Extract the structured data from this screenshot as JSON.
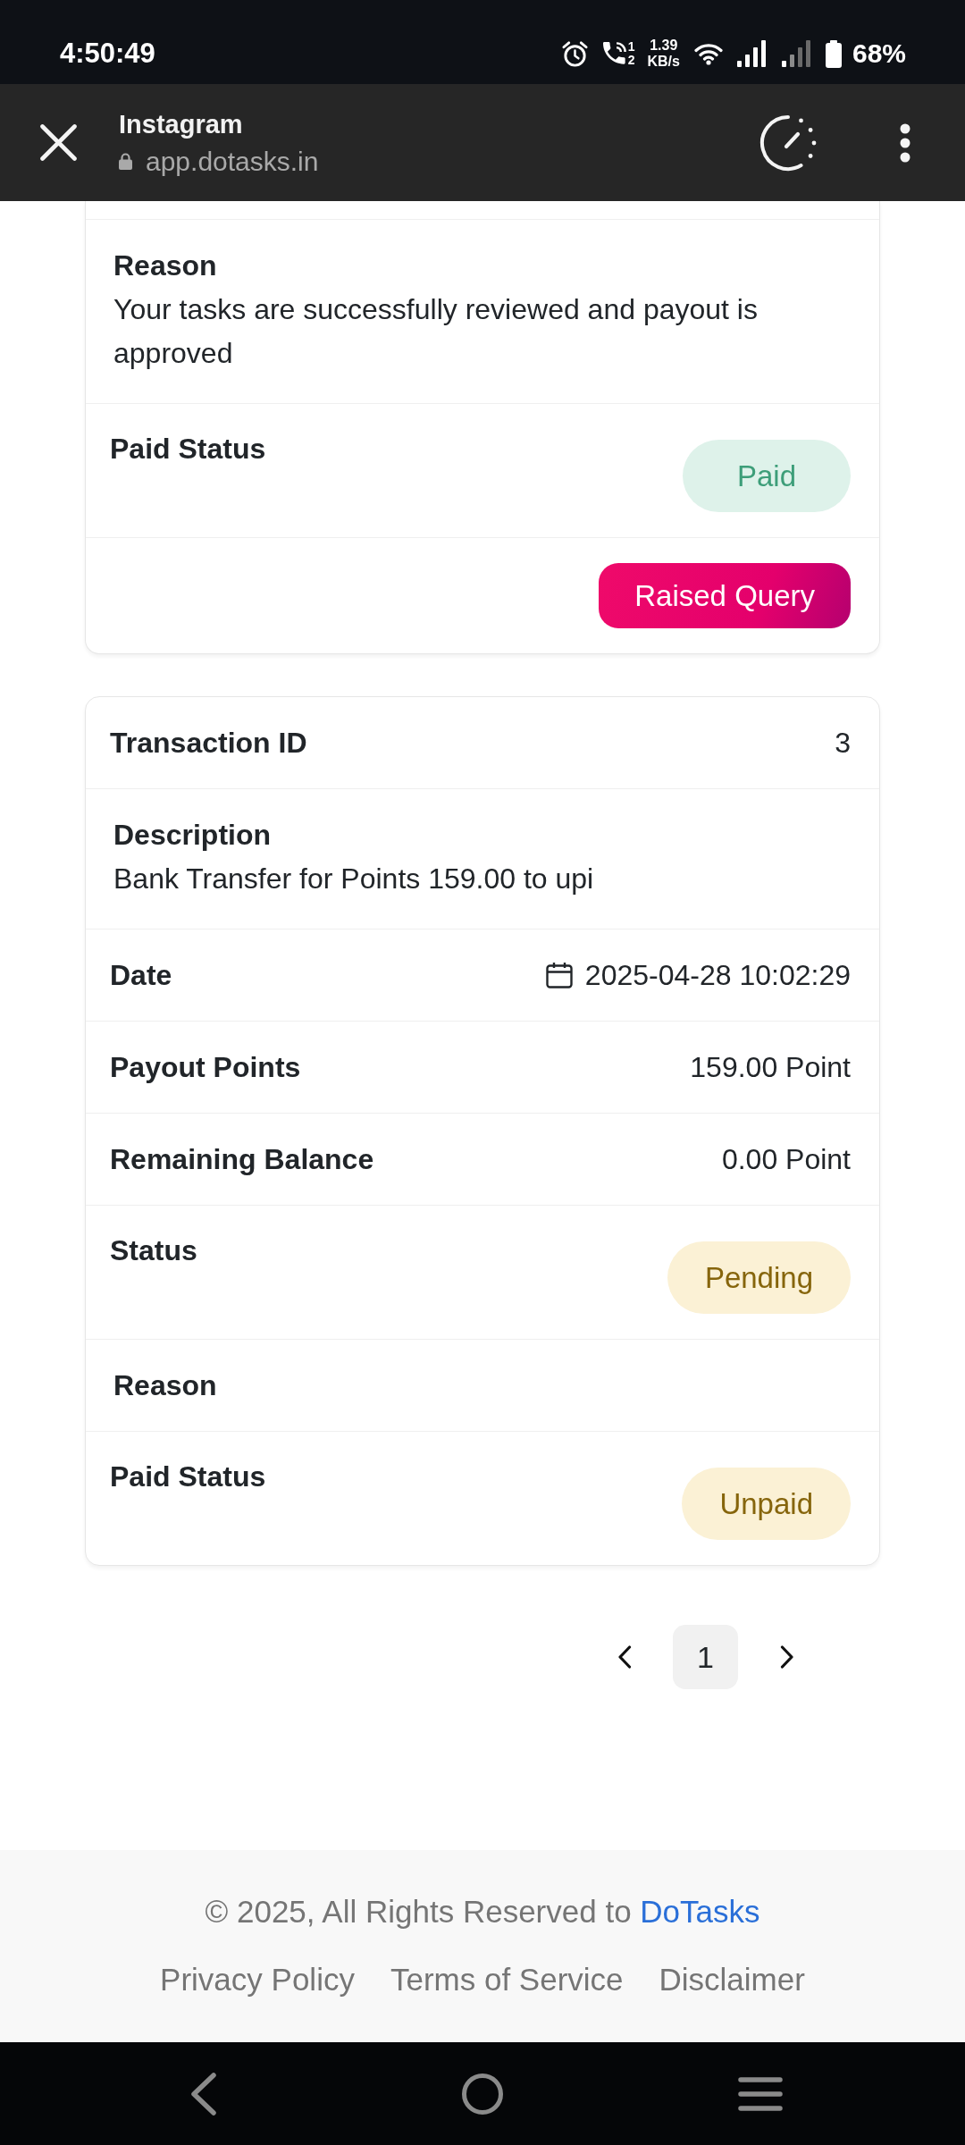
{
  "status_bar": {
    "time": "4:50:49",
    "call_lines": [
      "1",
      "2"
    ],
    "net_speed": {
      "value": "1.39",
      "unit": "KB/s"
    },
    "battery": "68%"
  },
  "browser_bar": {
    "title": "Instagram",
    "url": "app.dotasks.in"
  },
  "transactions": [
    {
      "clipped_top": true,
      "rows": [
        {
          "kind": "block",
          "label": "Reason",
          "value": "Your tasks are successfully reviewed and payout is approved"
        },
        {
          "kind": "badge",
          "label": "Paid Status",
          "badge": {
            "text": "Paid",
            "color": "#3d9e79"
          }
        },
        {
          "kind": "action",
          "button": "Raised Query"
        }
      ]
    },
    {
      "clipped_top": false,
      "rows": [
        {
          "kind": "inline",
          "label": "Transaction ID",
          "value": "3"
        },
        {
          "kind": "block",
          "label": "Description",
          "value": "Bank Transfer for Points 159.00 to upi"
        },
        {
          "kind": "date",
          "label": "Date",
          "value": "2025-04-28 10:02:29"
        },
        {
          "kind": "inline",
          "label": "Payout Points",
          "value": "159.00 Point"
        },
        {
          "kind": "inline",
          "label": "Remaining Balance",
          "value": "0.00 Point"
        },
        {
          "kind": "badge",
          "label": "Status",
          "badge": {
            "text": "Pending",
            "color": "#86650c"
          }
        },
        {
          "kind": "block",
          "label": "Reason"
        },
        {
          "kind": "badge",
          "label": "Paid Status",
          "badge": {
            "text": "Unpaid",
            "color": "#86650c"
          }
        }
      ]
    }
  ],
  "pagination": {
    "pages": [
      {
        "label": "1",
        "selected": true
      }
    ]
  },
  "footer": {
    "copyright": "© 2025, All Rights Reserved to",
    "brand": "DoTasks",
    "links": [
      "Privacy Policy",
      "Terms of Service",
      "Disclaimer"
    ]
  }
}
